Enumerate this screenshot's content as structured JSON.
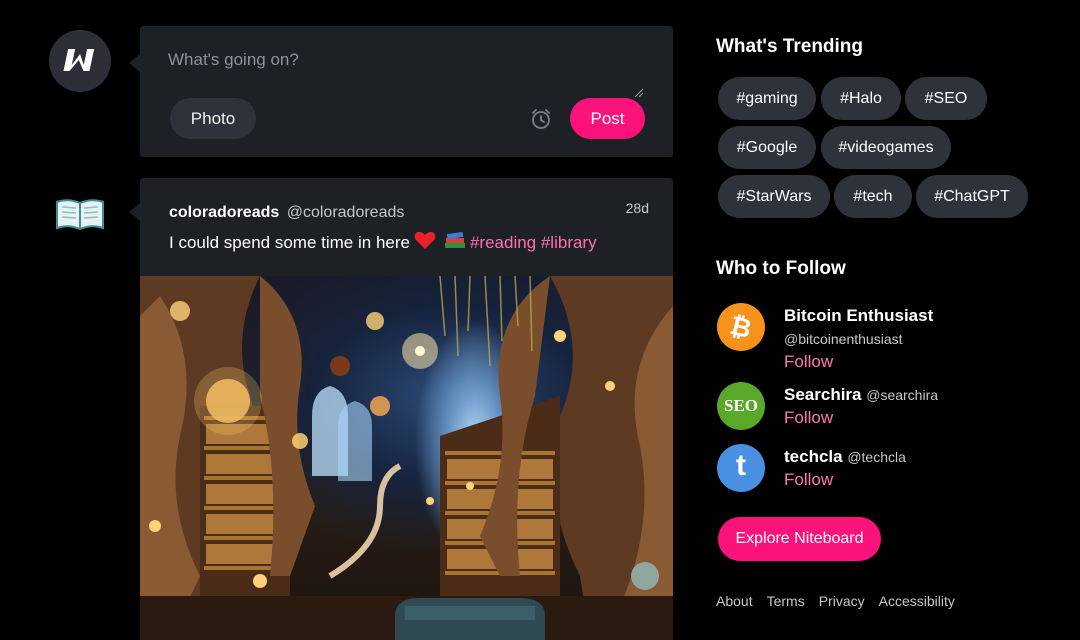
{
  "composer": {
    "placeholder": "What's going on?",
    "photo_label": "Photo",
    "post_label": "Post"
  },
  "post": {
    "author_name": "coloradoreads",
    "author_handle": "@coloradoreads",
    "time": "28d",
    "text": "I could spend some time in here",
    "emoji_heart": "❤️",
    "emoji_books": "📚",
    "hashtags": "#reading #library"
  },
  "trending": {
    "title": "What's Trending",
    "tags": [
      "#gaming",
      "#Halo",
      "#SEO",
      "#Google",
      "#videogames",
      "#StarWars",
      "#tech",
      "#ChatGPT"
    ]
  },
  "who_to_follow": {
    "title": "Who to Follow",
    "users": [
      {
        "name": "Bitcoin Enthusiast",
        "handle": "@bitcoinenthusiast",
        "follow": "Follow",
        "avatar_color": "#f7931a",
        "avatar_text": "₿"
      },
      {
        "name": "Searchira",
        "handle": "@searchira",
        "follow": "Follow",
        "avatar_color": "#5aa82a",
        "avatar_text": "SEO"
      },
      {
        "name": "techcla",
        "handle": "@techcla",
        "follow": "Follow",
        "avatar_color": "#4a90e2",
        "avatar_text": "t"
      }
    ]
  },
  "explore_label": "Explore Niteboard",
  "footer": [
    "About",
    "Terms",
    "Privacy",
    "Accessibility"
  ],
  "colors": {
    "accent": "#fb137c",
    "link": "#ff77b5",
    "card": "#1d2025",
    "chip": "#2e323a"
  }
}
